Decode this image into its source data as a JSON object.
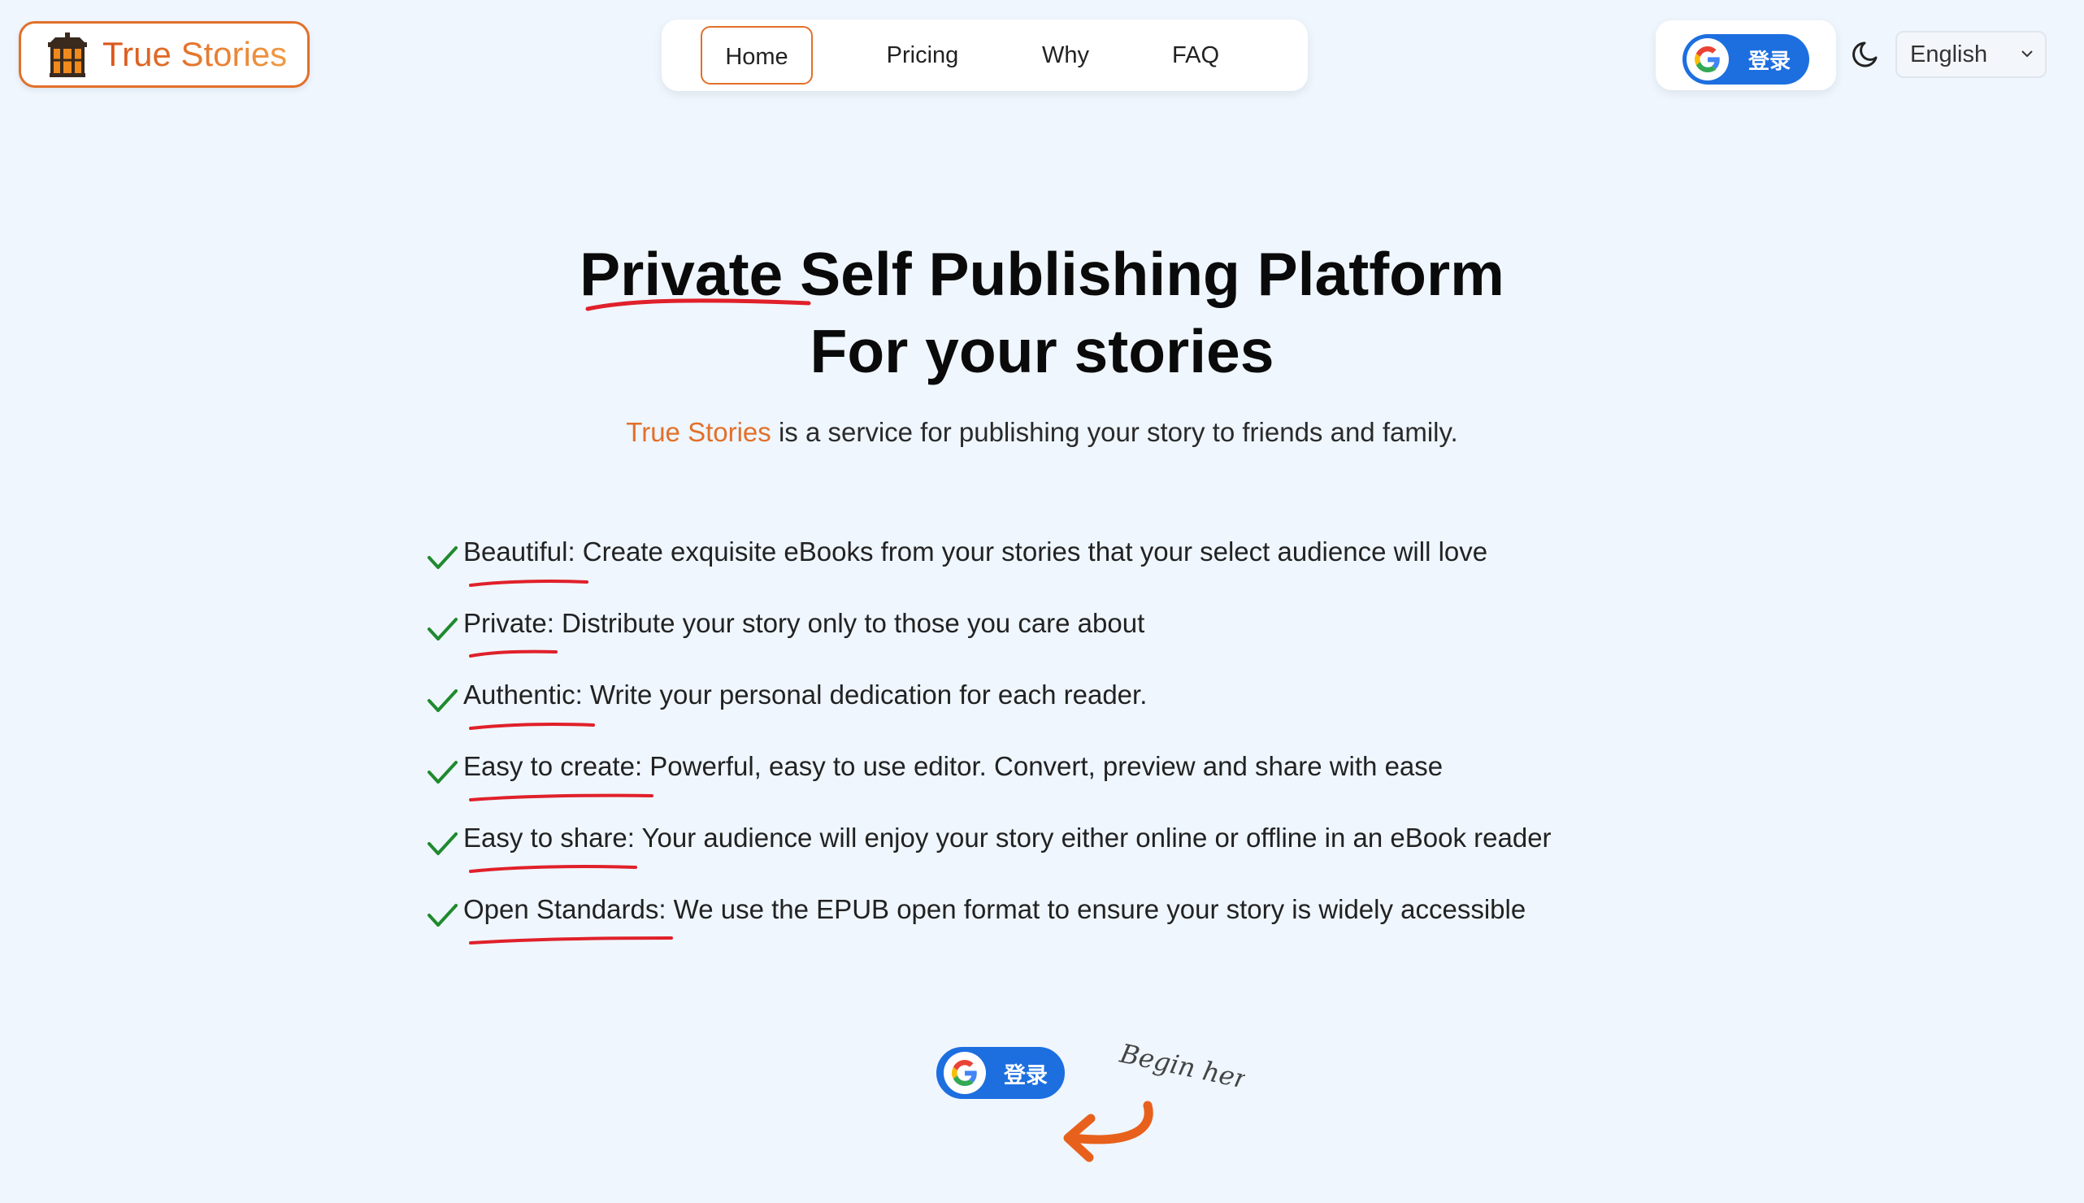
{
  "header": {
    "brand": "True Stories",
    "nav": [
      "Home",
      "Pricing",
      "Why",
      "FAQ"
    ],
    "signin_label": "登录",
    "language": "English"
  },
  "hero": {
    "title_highlight": "Private",
    "title_rest": " Self Publishing Platform",
    "title_line2": "For your stories",
    "subtitle_brand": "True Stories",
    "subtitle_rest": " is a service for publishing your story to friends and family."
  },
  "features": [
    {
      "title": "Beautiful",
      "text": ": Create exquisite eBooks from your stories that your select audience will love"
    },
    {
      "title": "Private",
      "text": ": Distribute your story only to those you care about"
    },
    {
      "title": "Authentic",
      "text": ": Write your personal dedication for each reader."
    },
    {
      "title": "Easy to create",
      "text": ": Powerful, easy to use editor. Convert, preview and share with ease"
    },
    {
      "title": "Easy to share",
      "text": ": Your audience will enjoy your story either online or offline in an eBook reader"
    },
    {
      "title": "Open Standards",
      "text": ": We use the EPUB open format to ensure your story is widely accessible"
    }
  ],
  "cta": {
    "signin_label": "登录",
    "hint": "Begin here"
  },
  "colors": {
    "accent": "#e2702a",
    "google_blue": "#1d6fe0",
    "check_green": "#1f8a2e",
    "underline_red": "#e0202a",
    "background": "#eff6fe"
  },
  "icons": {
    "logo": "lantern-icon",
    "google": "google-icon",
    "theme": "moon-icon",
    "dropdown": "chevron-down-icon",
    "feature_bullet": "check-icon",
    "cta_pointer": "curved-arrow-icon"
  }
}
